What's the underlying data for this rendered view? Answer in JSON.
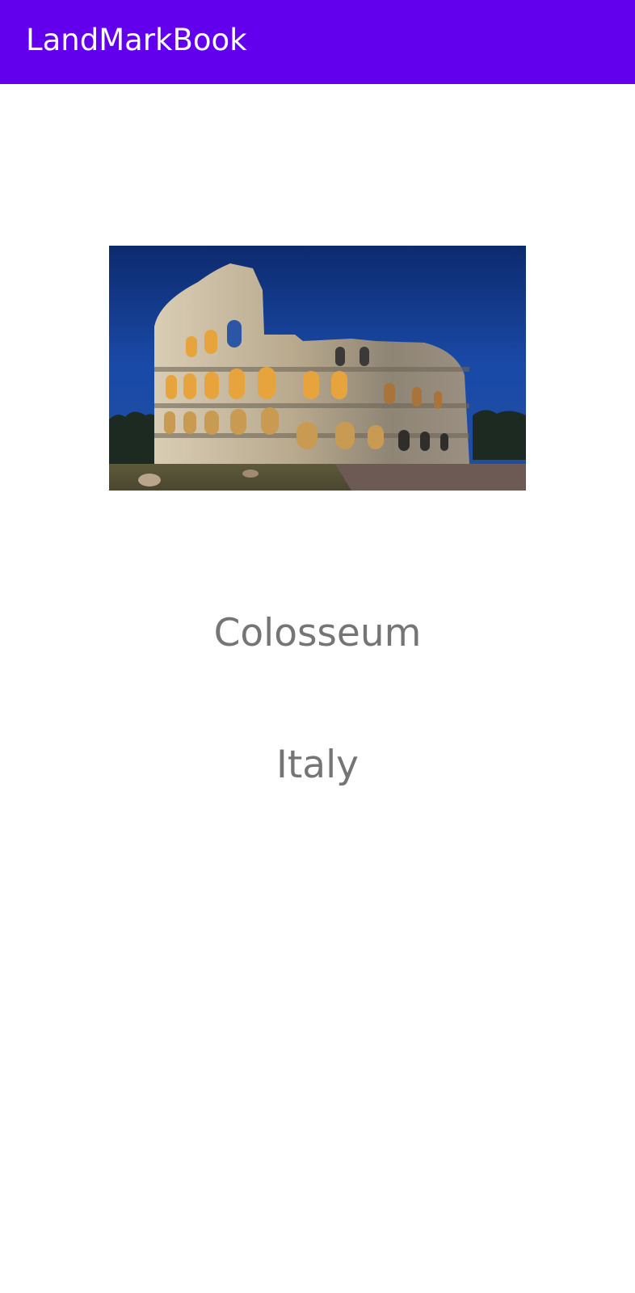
{
  "app_bar": {
    "title": "LandMarkBook",
    "color": "#6200EE"
  },
  "landmark": {
    "image_subject": "colosseum-photo",
    "name": "Colosseum",
    "country": "Italy",
    "text_color": "#757575"
  }
}
